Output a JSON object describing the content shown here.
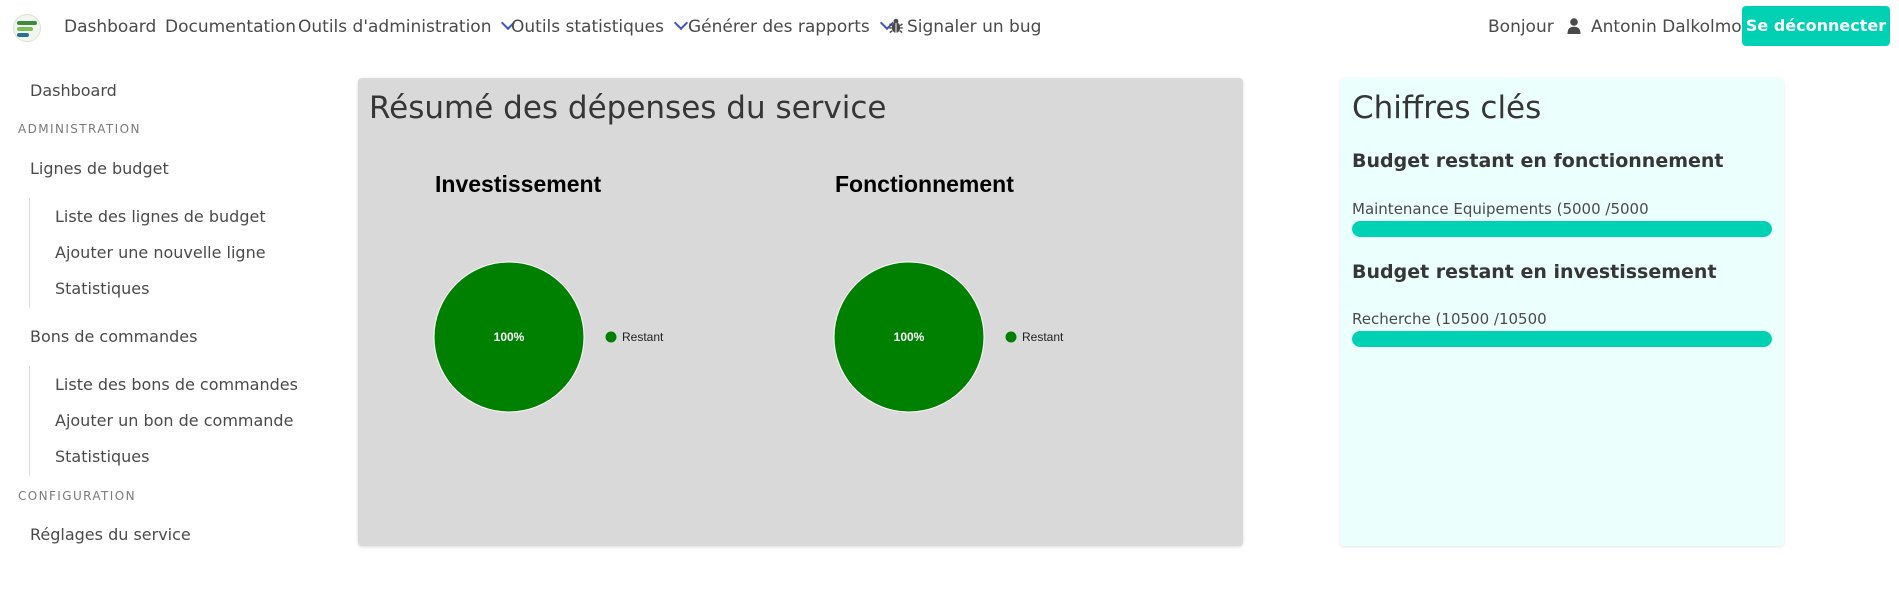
{
  "navbar": {
    "items": [
      {
        "label": "Dashboard"
      },
      {
        "label": "Documentation"
      },
      {
        "label": "Outils d'administration"
      },
      {
        "label": "Outils statistiques"
      },
      {
        "label": "Générer des rapports"
      },
      {
        "label": "Signaler un bug"
      }
    ],
    "greeting": "Bonjour",
    "user_name": "Antonin Dalkolmo",
    "logout_label": "Se déconnecter"
  },
  "sidebar": {
    "dashboard": "Dashboard",
    "admin_label": "ADMINISTRATION",
    "budget_lines": "Lignes de budget",
    "budget_items": [
      "Liste des lignes de budget",
      "Ajouter une nouvelle ligne",
      "Statistiques"
    ],
    "orders": "Bons de commandes",
    "order_items": [
      "Liste des bons de commandes",
      "Ajouter un bon de commande",
      "Statistiques"
    ],
    "config_label": "CONFIGURATION",
    "settings": "Réglages du service"
  },
  "summary": {
    "title": "Résumé des dépenses du service"
  },
  "chart_data": [
    {
      "type": "pie",
      "title": "Investissement",
      "categories": [
        "Restant"
      ],
      "values": [
        100
      ],
      "labels": [
        "100%"
      ],
      "colors": [
        "#008000"
      ],
      "legend": "right"
    },
    {
      "type": "pie",
      "title": "Fonctionnement",
      "categories": [
        "Restant"
      ],
      "values": [
        100
      ],
      "labels": [
        "100%"
      ],
      "colors": [
        "#008000"
      ],
      "legend": "right"
    }
  ],
  "key_figures": {
    "title": "Chiffres clés",
    "operating_title": "Budget restant en fonctionnement",
    "operating_item": {
      "label": "Maintenance Equipements (5000 /5000",
      "fraction": 1.0
    },
    "investment_title": "Budget restant en investissement",
    "investment_item": {
      "label": "Recherche (10500 /10500",
      "fraction": 1.0
    }
  },
  "colors": {
    "accent": "#00d1b2",
    "nav_chevron": "#3e56c4",
    "summary_bg": "#d9d9d9",
    "keyfig_bg": "#ebfffc",
    "pie_green": "#008000"
  }
}
